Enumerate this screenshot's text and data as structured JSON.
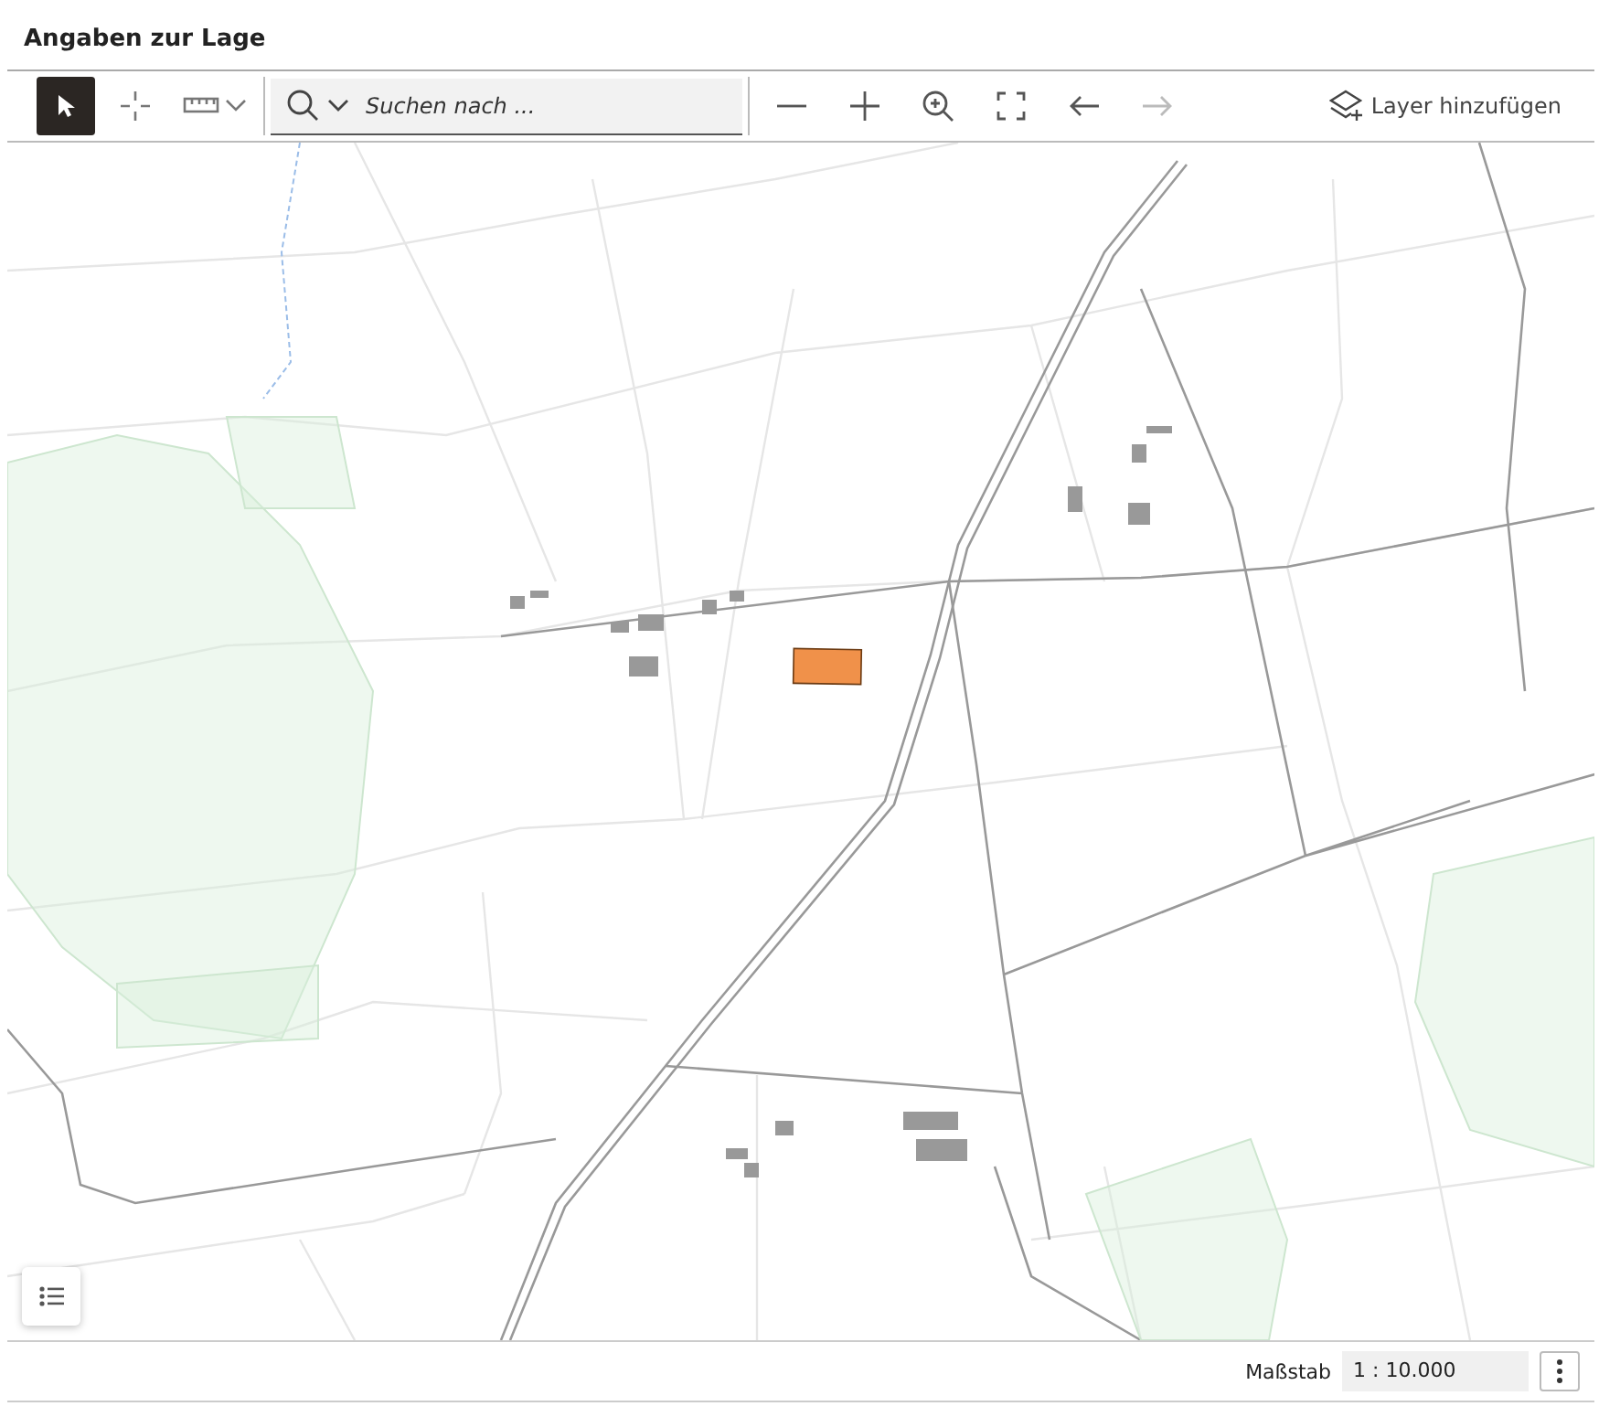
{
  "title": "Angaben zur Lage",
  "tools": [
    {
      "kind": "pointer",
      "selected": true
    },
    {
      "kind": "crosshair",
      "selected": false
    },
    {
      "kind": "ruler",
      "selected": false
    }
  ],
  "search": {
    "placeholder": "Suchen nach ..."
  },
  "nav": [
    {
      "kind": "zoom-out",
      "disabled": false
    },
    {
      "kind": "zoom-in",
      "disabled": false
    },
    {
      "kind": "magnify",
      "disabled": false
    },
    {
      "kind": "extent",
      "disabled": false
    },
    {
      "kind": "back",
      "disabled": false
    },
    {
      "kind": "forward",
      "disabled": true
    }
  ],
  "layer_button": {
    "label": "Layer hinzufügen"
  },
  "scale": {
    "label": "Maßstab",
    "value": "1 : 10.000"
  }
}
